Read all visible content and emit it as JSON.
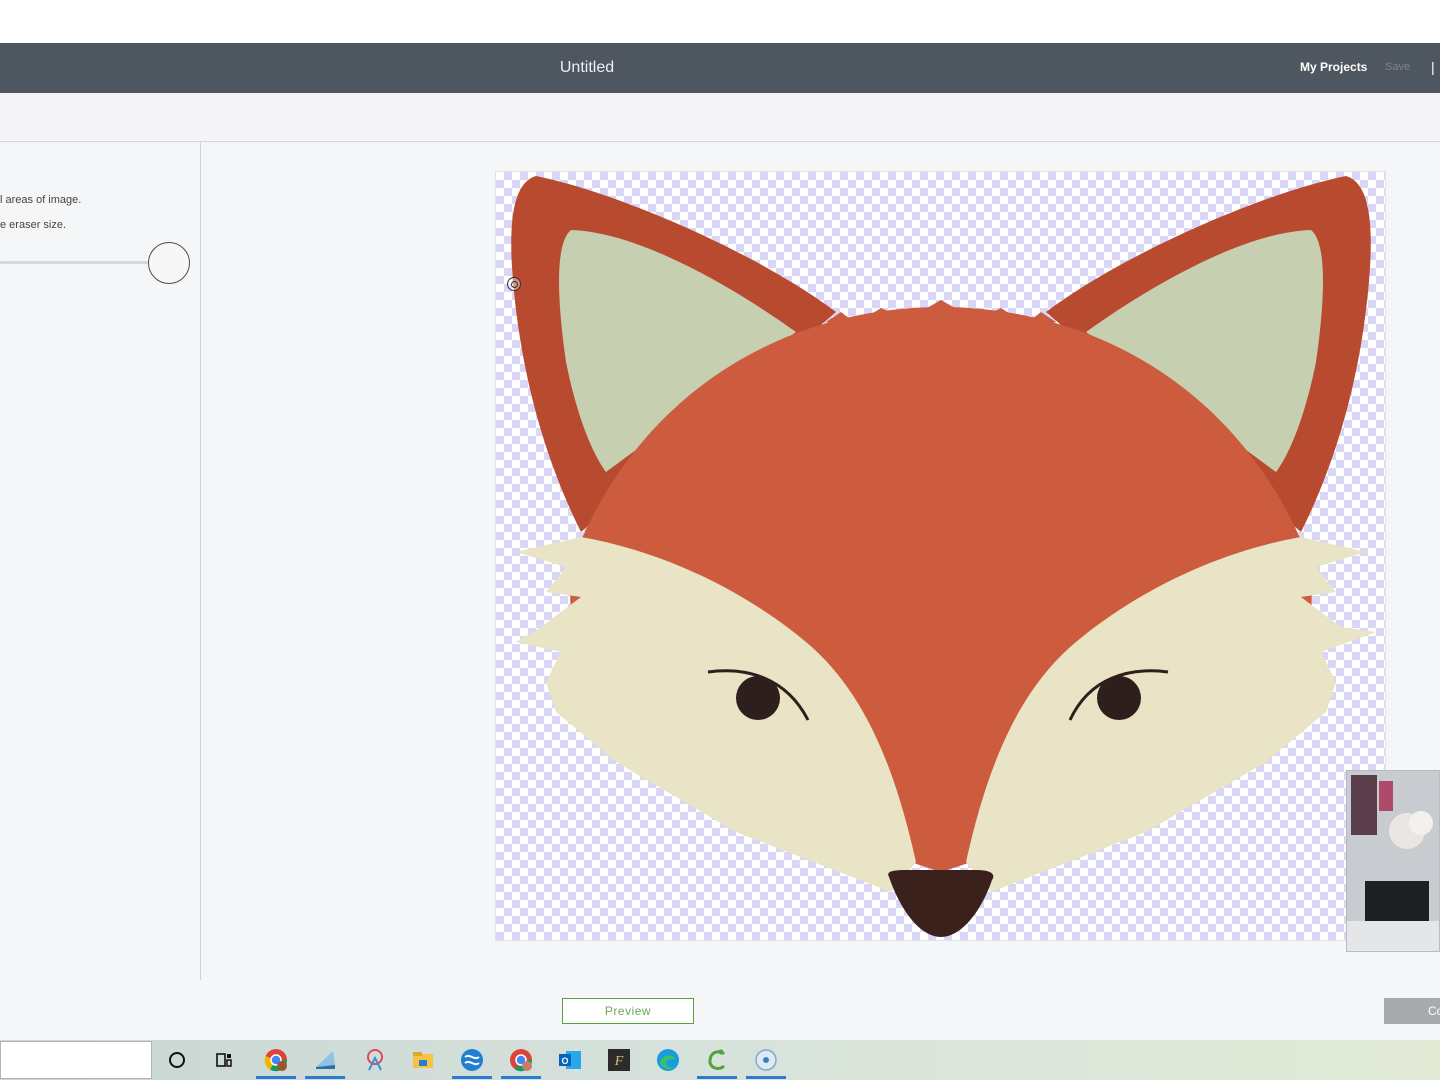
{
  "header": {
    "title": "Untitled",
    "my_projects": "My Projects",
    "save": "Save",
    "separator": "|"
  },
  "left_panel": {
    "hint_1": "l areas of image.",
    "hint_2": "e eraser size.",
    "eraser_size_slider": {
      "value_fraction": 1.0
    }
  },
  "bottom": {
    "preview_label": "Preview",
    "continue_label": "Co"
  },
  "canvas": {
    "image": "fox-face",
    "background": "transparency-checkerboard",
    "colors": {
      "ear_outer": "#b84b2f",
      "ear_inner": "#c6cfb0",
      "fur": "#cd5b3e",
      "cheek": "#e8e4c5",
      "nose": "#3a211c",
      "eye": "#2e1f1c",
      "checker": "#d9d6f6"
    }
  },
  "taskbar": {
    "icons": [
      "cortana-icon",
      "task-view-icon",
      "chrome-icon",
      "app-icon",
      "snip-icon",
      "file-explorer-icon",
      "app-icon-2",
      "chrome-profile-icon",
      "outlook-icon",
      "app-f-icon",
      "edge-icon",
      "cricut-icon",
      "record-icon"
    ]
  },
  "theme": {
    "header_bg": "#4e5660",
    "accent_green": "#5aa13f",
    "panel_bg": "#f5f6f7"
  }
}
